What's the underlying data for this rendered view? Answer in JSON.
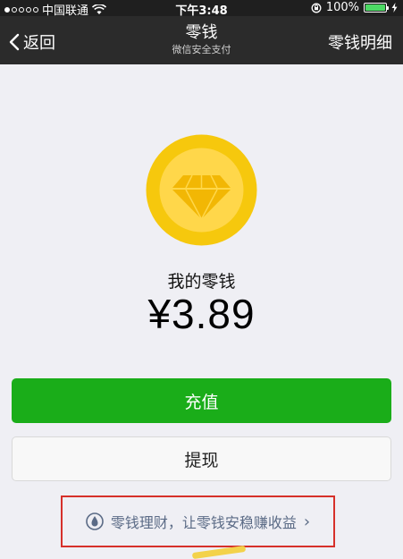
{
  "status_bar": {
    "carrier": "中国联通",
    "time": "下午3:48",
    "battery_percent": "100%",
    "battery_level": 1.0,
    "signal_bars": 1,
    "icons": [
      "signal-dots-icon",
      "wifi-icon",
      "rotation-lock-icon",
      "battery-icon",
      "charging-bolt-icon"
    ]
  },
  "nav": {
    "back_label": "返回",
    "title": "零钱",
    "subtitle": "微信安全支付",
    "right_label": "零钱明细"
  },
  "wallet": {
    "icon": "diamond-coin-icon",
    "label": "我的零钱",
    "amount": "¥3.89"
  },
  "actions": {
    "recharge_label": "充值",
    "withdraw_label": "提现"
  },
  "finance": {
    "icon": "finance-drop-icon",
    "text": "零钱理财，让零钱安稳赚收益",
    "chevron": "›"
  },
  "colors": {
    "status_bar_bg": "#1f1f1f",
    "nav_bg": "#2b2b2b",
    "page_bg": "#efeff4",
    "primary_green": "#1aad19",
    "coin_gold": "#f6c80d",
    "coin_inner": "#ffd74a",
    "highlight_red": "#d6302a",
    "link_blue_gray": "#5b6b86"
  }
}
